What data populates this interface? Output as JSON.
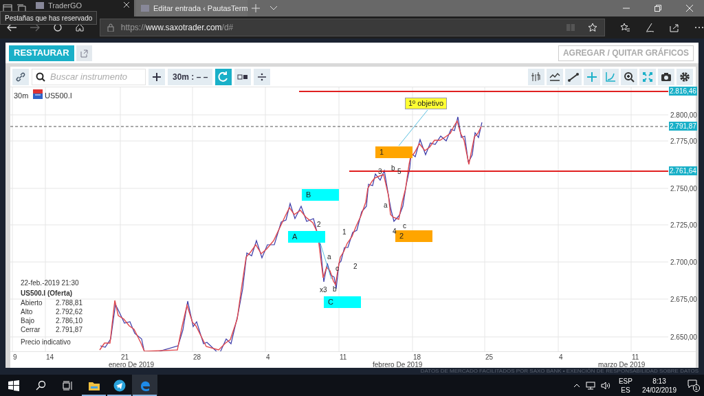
{
  "browser": {
    "tabs": [
      {
        "title": "TraderGO",
        "selected": true
      },
      {
        "title": "Editar entrada ‹ PautasTerm",
        "selected": false
      }
    ],
    "tooltip": "Pestañas que has reservado",
    "url_scheme": "https://",
    "url_host": "www.saxotrader.com",
    "url_path": "/d#"
  },
  "app": {
    "restore_button": "RESTAURAR",
    "charts_button": "AGREGAR / QUITAR GRÁFICOS"
  },
  "toolbar": {
    "search": {
      "placeholder": "Buscar instrumento"
    },
    "interval": "30m : – –",
    "refresh_on": true,
    "tools": [
      {
        "kind": "bars",
        "active": false
      },
      {
        "kind": "studies",
        "active": false
      },
      {
        "kind": "line",
        "active": false
      },
      {
        "kind": "crosshair",
        "active": true
      },
      {
        "kind": "curve",
        "active": true
      },
      {
        "kind": "zoom",
        "active": false
      },
      {
        "kind": "fit",
        "active": true
      },
      {
        "kind": "camera",
        "active": false
      },
      {
        "kind": "settings",
        "active": false
      }
    ]
  },
  "chart": {
    "interval": "30m",
    "instrument": "US500.I",
    "price_levels": [
      {
        "label": "2.816,46",
        "kind": "solid"
      },
      {
        "label": "2.791,87",
        "kind": "dashed"
      },
      {
        "label": "2.761,64",
        "kind": "solid"
      }
    ],
    "y_ticks": [
      "2.800,00",
      "2.775,00",
      "2.750,00",
      "2.725,00",
      "2.700,00",
      "2.675,00",
      "2.650,00"
    ],
    "x_ticks": [
      "9",
      "14",
      "21",
      "28",
      "4",
      "11",
      "18",
      "25",
      "4",
      "11"
    ],
    "months": [
      "enero De 2019",
      "febrero De 2019",
      "marzo De 2019"
    ],
    "wave_boxes": [
      {
        "text": "B",
        "color": "#00ffff"
      },
      {
        "text": "A",
        "color": "#00ffff"
      },
      {
        "text": "C",
        "color": "#00ffff"
      },
      {
        "text": "1",
        "color": "#ffa500"
      },
      {
        "text": "2",
        "color": "#ffa500"
      }
    ],
    "wave_labels": [
      "2",
      "1",
      "a",
      "c",
      "2",
      "x3",
      "b",
      "3",
      "b",
      "5",
      "a",
      "4",
      "c"
    ],
    "target_label": "1º objetivo",
    "info": {
      "datetime": "22-feb.-2019 21:30",
      "title": "US500.I (Oferta)",
      "rows": [
        {
          "label": "Abierto",
          "value": "2.788,81"
        },
        {
          "label": "Alto",
          "value": "2.792,62"
        },
        {
          "label": "Bajo",
          "value": "2.786,10"
        },
        {
          "label": "Cerrar",
          "value": "2.791,87"
        }
      ],
      "note": "Precio indicativo"
    }
  },
  "footer": "DATOS DE MERCADO FACILITADOS POR SAXO BANK • EXENCIÓN DE RESPONSABILIDAD SOBRE DATOS",
  "taskbar": {
    "apps": [
      {
        "kind": "explorer",
        "running": true,
        "selected": false
      },
      {
        "kind": "telegram",
        "running": true,
        "selected": false
      },
      {
        "kind": "edge",
        "running": true,
        "selected": true
      }
    ],
    "language": "ESP",
    "layout": "ES",
    "time": "8:13",
    "date": "24/02/2019",
    "notifications": "1"
  }
}
